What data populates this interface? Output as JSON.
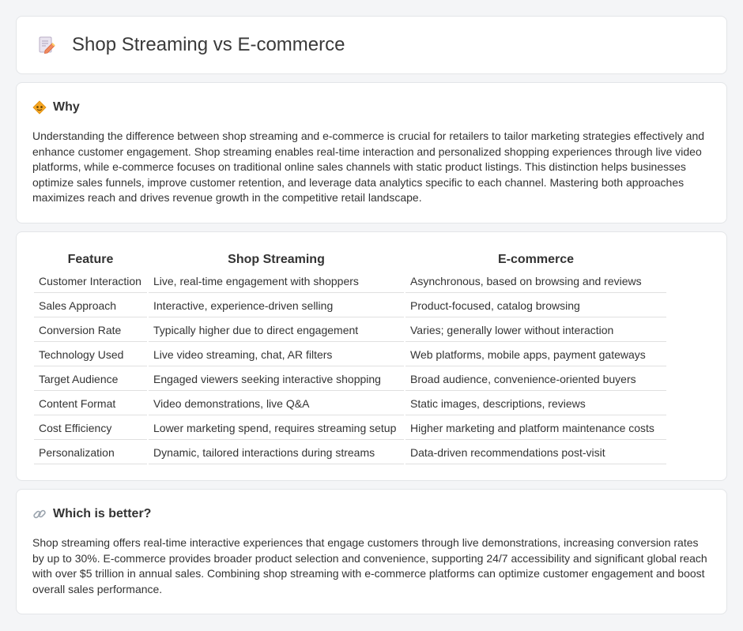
{
  "header": {
    "title": "Shop Streaming vs E-commerce",
    "icon": "document-pencil-icon"
  },
  "why": {
    "title": "Why",
    "icon": "warning-diamond-icon",
    "text": "Understanding the difference between shop streaming and e-commerce is crucial for retailers to tailor marketing strategies effectively and enhance customer engagement. Shop streaming enables real-time interaction and personalized shopping experiences through live video platforms, while e-commerce focuses on traditional online sales channels with static product listings. This distinction helps businesses optimize sales funnels, improve customer retention, and leverage data analytics specific to each channel. Mastering both approaches maximizes reach and drives revenue growth in the competitive retail landscape."
  },
  "comparison": {
    "headers": [
      "Feature",
      "Shop Streaming",
      "E-commerce"
    ],
    "rows": [
      [
        "Customer Interaction",
        "Live, real-time engagement with shoppers",
        "Asynchronous, based on browsing and reviews"
      ],
      [
        "Sales Approach",
        "Interactive, experience-driven selling",
        "Product-focused, catalog browsing"
      ],
      [
        "Conversion Rate",
        "Typically higher due to direct engagement",
        "Varies; generally lower without interaction"
      ],
      [
        "Technology Used",
        "Live video streaming, chat, AR filters",
        "Web platforms, mobile apps, payment gateways"
      ],
      [
        "Target Audience",
        "Engaged viewers seeking interactive shopping",
        "Broad audience, convenience-oriented buyers"
      ],
      [
        "Content Format",
        "Video demonstrations, live Q&A",
        "Static images, descriptions, reviews"
      ],
      [
        "Cost Efficiency",
        "Lower marketing spend, requires streaming setup",
        "Higher marketing and platform maintenance costs"
      ],
      [
        "Personalization",
        "Dynamic, tailored interactions during streams",
        "Data-driven recommendations post-visit"
      ]
    ]
  },
  "better": {
    "title": "Which is better?",
    "icon": "link-icon",
    "text": "Shop streaming offers real-time interactive experiences that engage customers through live demonstrations, increasing conversion rates by up to 30%. E-commerce provides broader product selection and convenience, supporting 24/7 accessibility and significant global reach with over $5 trillion in annual sales. Combining shop streaming with e-commerce platforms can optimize customer engagement and boost overall sales performance."
  },
  "colors": {
    "background": "#f4f5f7",
    "card": "#ffffff",
    "border": "#e3e5e8",
    "accent_orange": "#f5a623"
  }
}
